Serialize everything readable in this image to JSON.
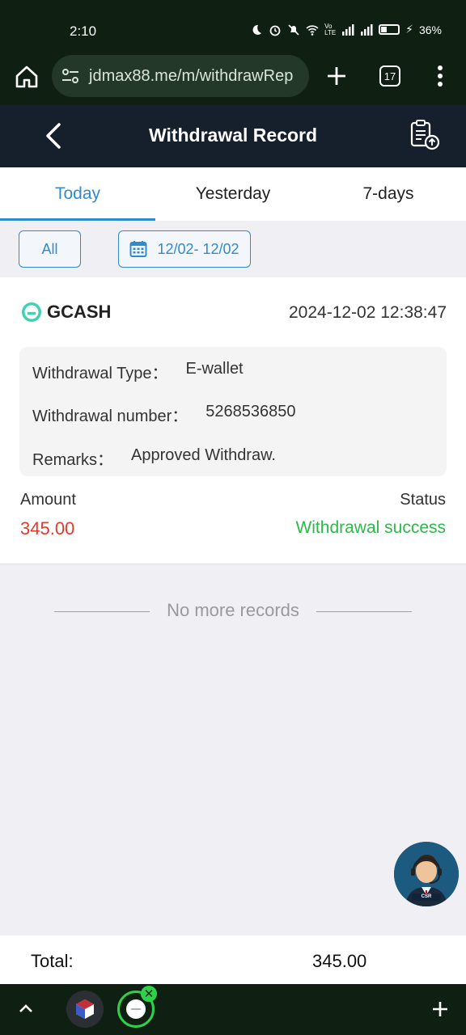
{
  "status_bar": {
    "time": "2:10",
    "battery": "36%",
    "volte": "Vo LTE"
  },
  "browser": {
    "url": "jdmax88.me/m/withdrawRep",
    "tab_count": "17"
  },
  "header": {
    "title": "Withdrawal Record"
  },
  "tabs": [
    {
      "label": "Today",
      "active": true
    },
    {
      "label": "Yesterday",
      "active": false
    },
    {
      "label": "7-days",
      "active": false
    }
  ],
  "filters": {
    "all_label": "All",
    "date_range": "12/02- 12/02"
  },
  "record": {
    "method": "GCASH",
    "datetime": "2024-12-02 12:38:47",
    "type_label": "Withdrawal Type：",
    "type_value": "E-wallet",
    "number_label": "Withdrawal number：",
    "number_value": "5268536850",
    "remarks_label": "Remarks：",
    "remarks_value": "Approved Withdraw.",
    "amount_label": "Amount",
    "amount_value": "345.00",
    "status_label": "Status",
    "status_value": "Withdrawal success"
  },
  "no_more_text": "No more records",
  "cs_avatar_text": "CSR",
  "total": {
    "label": "Total:",
    "value": "345.00"
  },
  "colors": {
    "accent": "#2f8bcc",
    "amount": "#e03c2c",
    "success": "#2db84a",
    "header_bg": "#16202c"
  },
  "icons": [
    "home-icon",
    "site-settings-icon",
    "plus-icon",
    "tabs-icon",
    "more-vert-icon",
    "back-icon",
    "export-record-icon",
    "calendar-icon",
    "gcash-logo-icon",
    "chevron-up-icon",
    "close-icon"
  ]
}
